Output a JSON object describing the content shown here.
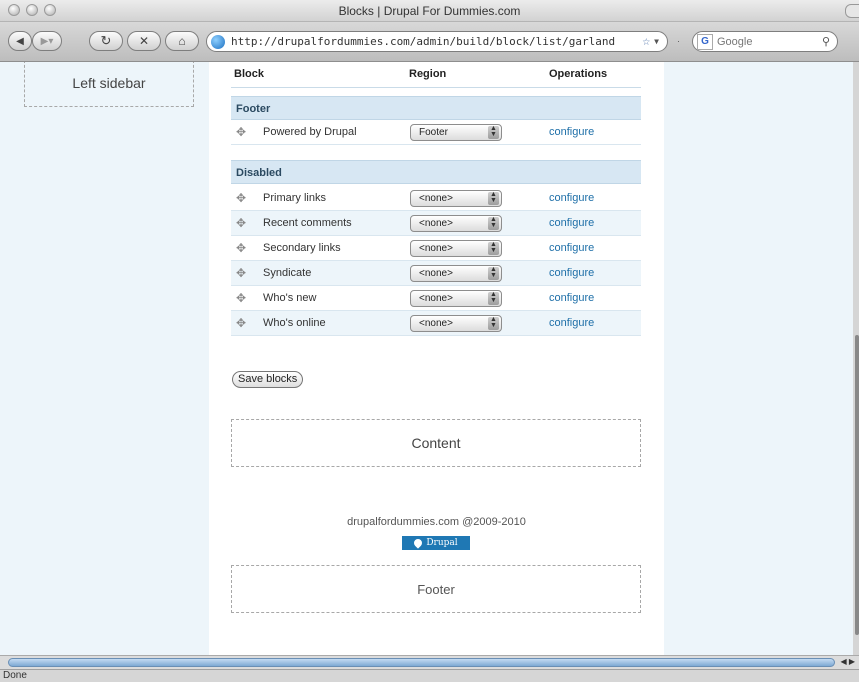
{
  "window": {
    "title": "Blocks | Drupal For Dummies.com"
  },
  "toolbar": {
    "url": "http://drupalfordummies.com/admin/build/block/list/garland",
    "search_placeholder": "Google"
  },
  "page": {
    "left_sidebar_label": "Left sidebar",
    "table": {
      "headers": {
        "block": "Block",
        "region": "Region",
        "operations": "Operations"
      },
      "sections": [
        {
          "title": "Footer",
          "rows": [
            {
              "name": "Powered by Drupal",
              "region": "Footer",
              "operation": "configure"
            }
          ]
        },
        {
          "title": "Disabled",
          "rows": [
            {
              "name": "Primary links",
              "region": "<none>",
              "operation": "configure"
            },
            {
              "name": "Recent comments",
              "region": "<none>",
              "operation": "configure"
            },
            {
              "name": "Secondary links",
              "region": "<none>",
              "operation": "configure"
            },
            {
              "name": "Syndicate",
              "region": "<none>",
              "operation": "configure"
            },
            {
              "name": "Who's new",
              "region": "<none>",
              "operation": "configure"
            },
            {
              "name": "Who's online",
              "region": "<none>",
              "operation": "configure"
            }
          ]
        }
      ]
    },
    "save_button": "Save blocks",
    "content_region_label": "Content",
    "footer_message": "drupalfordummies.com @2009-2010",
    "drupal_badge": "Drupal",
    "footer_region_label": "Footer"
  },
  "status": {
    "text": "Done"
  }
}
